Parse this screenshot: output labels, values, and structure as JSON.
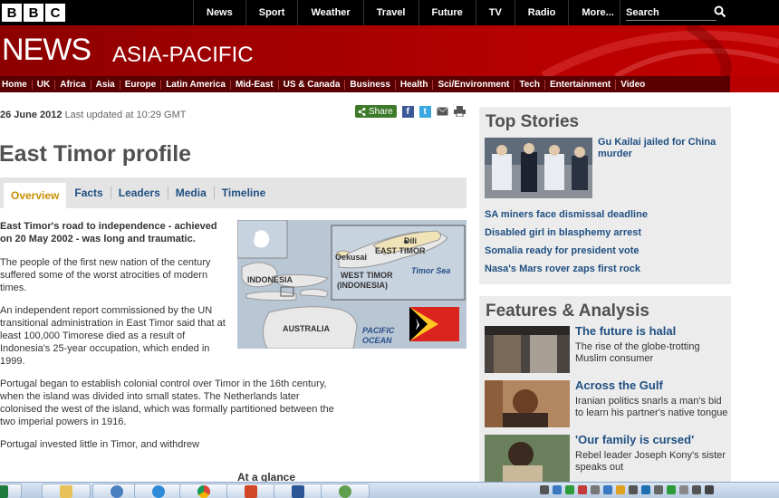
{
  "header": {
    "logo_letters": [
      "B",
      "B",
      "C"
    ],
    "nav": [
      "News",
      "Sport",
      "Weather",
      "Travel",
      "Future",
      "TV",
      "Radio",
      "More..."
    ],
    "search_placeholder": "Search",
    "banner_title": "NEWS",
    "banner_region": "ASIA-PACIFIC"
  },
  "section_nav": [
    "Home",
    "UK",
    "Africa",
    "Asia",
    "Europe",
    "Latin America",
    "Mid-East",
    "US & Canada",
    "Business",
    "Health",
    "Sci/Environment",
    "Tech",
    "Entertainment",
    "Video"
  ],
  "article": {
    "date": "26 June 2012",
    "updated": "Last updated at 10:29 GMT",
    "share_label": "Share",
    "title": "East Timor profile",
    "tabs": [
      "Overview",
      "Facts",
      "Leaders",
      "Media",
      "Timeline"
    ],
    "active_tab": "Overview",
    "lead": "East Timor's road to independence - achieved on 20 May 2002 - was long and traumatic.",
    "paragraphs": [
      "The people of the first new nation of the century suffered some of the worst atrocities of modern times.",
      "An independent report commissioned by the UN transitional administration in East Timor said that at least 100,000 Timorese died as a result of Indonesia's 25-year occupation, which ended in 1999.",
      "Portugal began to establish colonial control over Timor in the 16th century, when the island was divided into small states. The Netherlands later colonised the west of the island, which was formally partitioned between the two imperial powers in 1916.",
      "Portugal invested little in Timor, and withdrew"
    ],
    "at_a_glance": "At a glance"
  },
  "map": {
    "labels": {
      "indonesia": "INDONESIA",
      "australia": "AUSTRALIA",
      "pacific": "PACIFIC",
      "ocean": "OCEAN",
      "east_timor": "EAST TIMOR",
      "dili": "Dili",
      "oekusai": "Oekusai",
      "west_timor_1": "WEST TIMOR",
      "west_timor_2": "(INDONESIA)",
      "timor_sea": "Timor Sea"
    }
  },
  "top_stories": {
    "title": "Top Stories",
    "lead_headline": "Gu Kailai jailed for China murder",
    "links": [
      "SA miners face dismissal deadline",
      "Disabled girl in blasphemy arrest",
      "Somalia ready for president vote",
      "Nasa's Mars rover zaps first rock"
    ]
  },
  "features": {
    "title": "Features & Analysis",
    "items": [
      {
        "headline": "The future is halal",
        "summary": "The rise of the globe-trotting Muslim consumer"
      },
      {
        "headline": "Across the Gulf",
        "summary": "Iranian politics snarls a man's bid to learn his partner's native tongue"
      },
      {
        "headline": "'Our family is cursed'",
        "summary": "Rebel leader Joseph Kony's sister speaks out"
      }
    ]
  },
  "colors": {
    "bbc_red": "#b80000",
    "link_blue": "#1f4f82",
    "active_tab": "#c89000"
  }
}
